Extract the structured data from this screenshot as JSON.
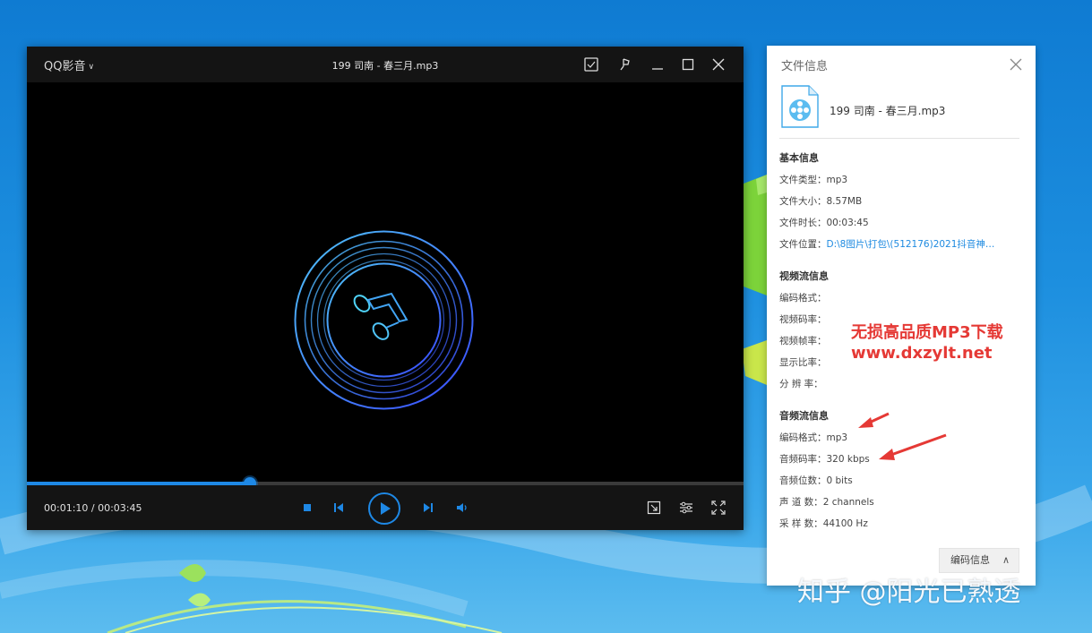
{
  "player": {
    "app_menu": "QQ影音",
    "title": "199 司南 - 春三月.mp3",
    "time": "00:01:10 / 00:03:45",
    "progress_fraction": 0.3111,
    "accent_color": "#1e88e5",
    "titlebar_icons": [
      "screenshot-icon",
      "pin-icon",
      "minimize-icon",
      "maximize-icon",
      "close-icon"
    ],
    "control_icons": [
      "stop-icon",
      "previous-icon",
      "play-icon",
      "next-icon",
      "volume-icon",
      "screenshot-icon",
      "settings-icon",
      "fullscreen-icon"
    ]
  },
  "info": {
    "title": "文件信息",
    "file_name": "199 司南 - 春三月.mp3",
    "basic": {
      "heading": "基本信息",
      "rows": [
        {
          "label": "文件类型：",
          "value": "mp3"
        },
        {
          "label": "文件大小：",
          "value": "8.57MB"
        },
        {
          "label": "文件时长：",
          "value": "00:03:45"
        },
        {
          "label": "文件位置：",
          "value": "D:\\8图片\\打包\\(512176)2021抖音神…"
        }
      ]
    },
    "video": {
      "heading": "视频流信息",
      "rows": [
        {
          "label": "编码格式：",
          "value": ""
        },
        {
          "label": "视频码率：",
          "value": ""
        },
        {
          "label": "视频帧率：",
          "value": ""
        },
        {
          "label": "显示比率：",
          "value": ""
        },
        {
          "label": "分 辨 率：",
          "value": ""
        }
      ]
    },
    "audio": {
      "heading": "音频流信息",
      "rows": [
        {
          "label": "编码格式：",
          "value": "mp3"
        },
        {
          "label": "音频码率：",
          "value": "320 kbps"
        },
        {
          "label": "音频位数：",
          "value": "0 bits"
        },
        {
          "label": "声 道 数：",
          "value": "2 channels"
        },
        {
          "label": "采 样 数：",
          "value": "44100 Hz"
        }
      ]
    },
    "codec_button": "编码信息",
    "link_color": "#1e8ae0"
  },
  "annotation": {
    "line1": "无损高品质MP3下载",
    "line2": "www.dxzylt.net",
    "color": "#e53935"
  },
  "watermark": "知乎 @阳光已熟透"
}
